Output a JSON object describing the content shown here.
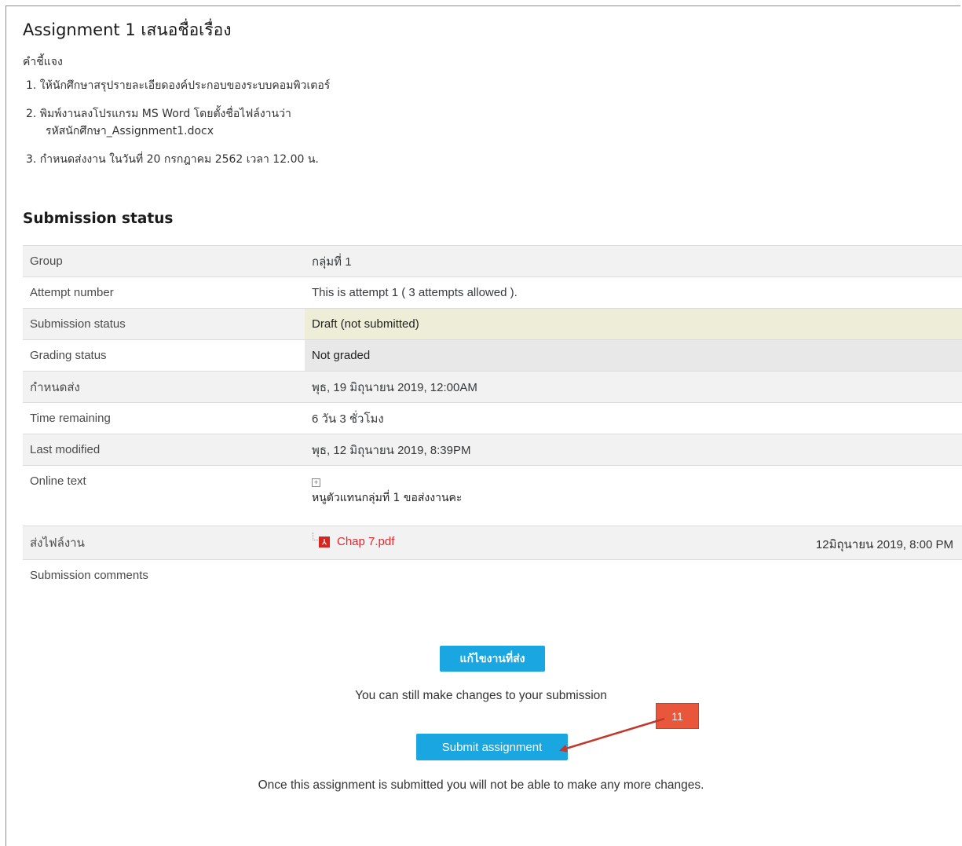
{
  "assignment": {
    "title": "Assignment 1 เสนอชื่อเรื่อง",
    "intro_label": "คำชี้แจง",
    "instructions": [
      "1. ให้นักศึกษาสรุปรายละเอียดองค์ประกอบของระบบคอมพิวเตอร์",
      "2. พิมพ์งานลงโปรแกรม  MS Word โดยตั้งชื่อไฟล์งานว่า",
      "รหัสนักศึกษา_Assignment1.docx",
      "3. กำหนดส่งงาน ในวันที่ 20 กรกฎาคม 2562 เวลา 12.00 น."
    ]
  },
  "submission": {
    "section_title": "Submission status",
    "rows": [
      {
        "label": "Group",
        "value": "กลุ่มที่ 1"
      },
      {
        "label": "Attempt number",
        "value": "This is attempt 1 ( 3 attempts allowed )."
      },
      {
        "label": "Submission status",
        "value": "Draft (not submitted)"
      },
      {
        "label": "Grading status",
        "value": "Not graded"
      },
      {
        "label": "กำหนดส่ง",
        "value": "พุธ, 19 มิถุนายน 2019, 12:00AM"
      },
      {
        "label": "Time remaining",
        "value": "6 วัน 3 ชั่วโมง"
      },
      {
        "label": "Last modified",
        "value": "พุธ, 12 มิถุนายน 2019, 8:39PM"
      },
      {
        "label": "Online text",
        "value": "หนูตัวแทนกลุ่มที่ 1 ขอส่งงานคะ"
      },
      {
        "label": "ส่งไฟล์งาน",
        "value": "Chap 7.pdf",
        "date": "12มิถุนายน 2019, 8:00 PM"
      },
      {
        "label": "Submission comments",
        "value": ""
      }
    ]
  },
  "actions": {
    "edit_button": "แก้ไขงานที่ส่ง",
    "edit_note": "You can still make changes to your submission",
    "submit_button": "Submit assignment",
    "submit_note": "Once this assignment is submitted you will not be able to make any more changes."
  },
  "annotation": {
    "callout_number": "11",
    "callout_color": "#e8573c",
    "arrow_color": "#c0392b"
  }
}
